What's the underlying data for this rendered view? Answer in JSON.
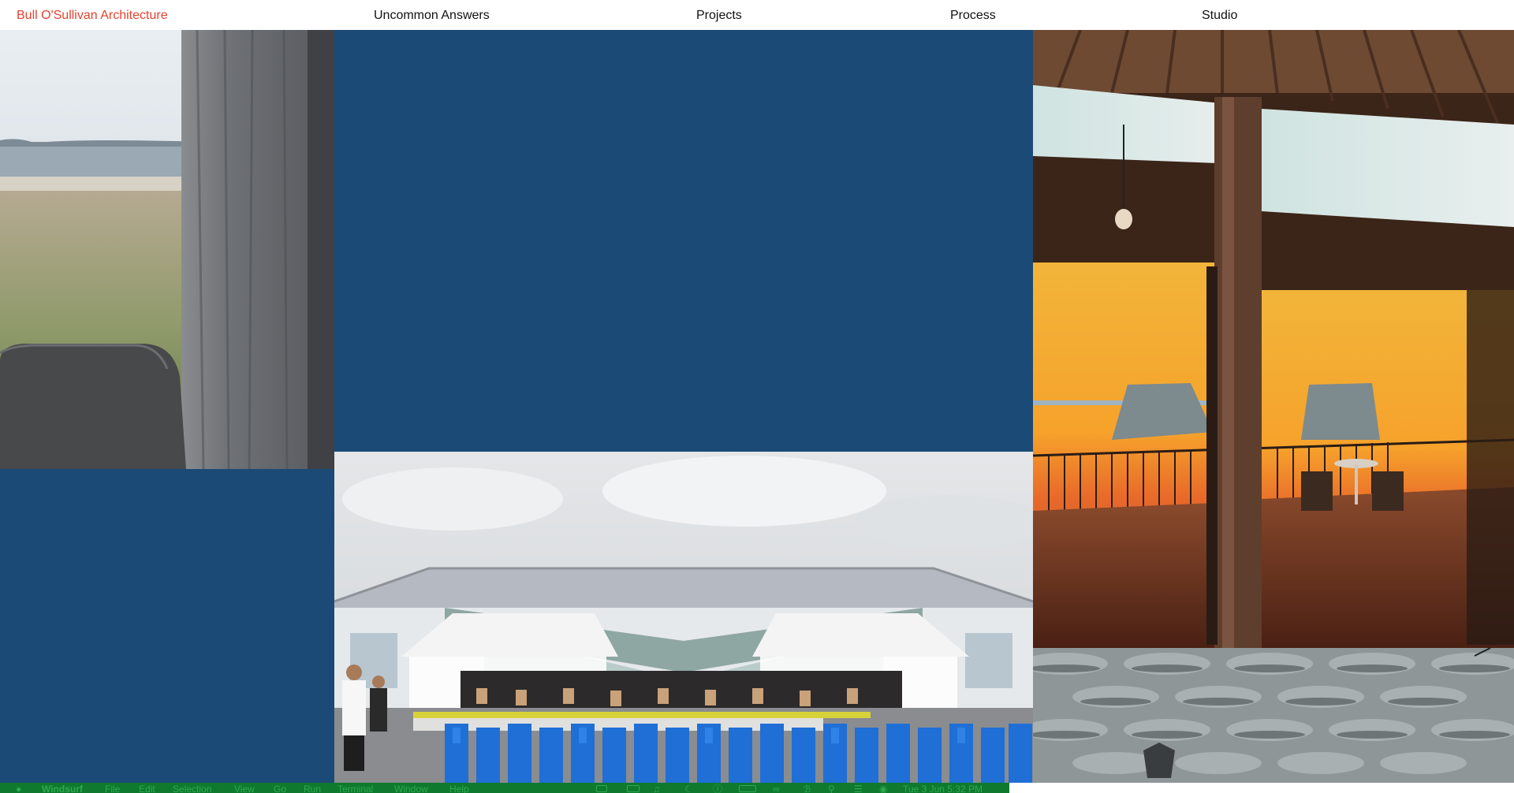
{
  "header": {
    "brand": "Bull O'Sullivan Architecture",
    "nav": {
      "uncommon_answers": "Uncommon Answers",
      "projects": "Projects",
      "process": "Process",
      "studio": "Studio"
    }
  },
  "colors": {
    "brand_red": "#e8412f",
    "tile_blue": "#1b4a76",
    "menubar_green": "#0f7a2e"
  },
  "menubar": {
    "app": "Windsurf",
    "items": [
      "File",
      "Edit",
      "Selection",
      "View",
      "Go",
      "Run",
      "Terminal",
      "Window",
      "Help"
    ],
    "clock": "Tue 3 Jun  5:32 PM",
    "icons": [
      "apple-icon",
      "display-icon",
      "volume-icon",
      "battery-icon",
      "bluetooth-icon",
      "search-icon",
      "control-center-icon"
    ]
  }
}
